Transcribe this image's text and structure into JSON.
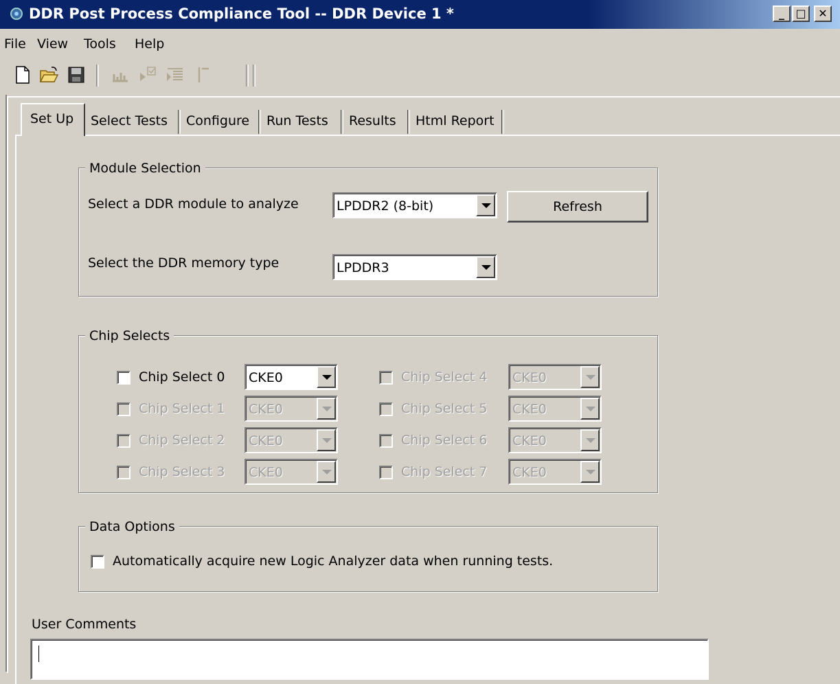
{
  "window": {
    "title": "DDR Post Process Compliance Tool -- DDR Device 1 *",
    "minimize_label": "_",
    "maximize_label": "□",
    "close_label": "✕"
  },
  "menu": {
    "items": [
      "File",
      "View",
      "Tools",
      "Help"
    ]
  },
  "toolbar": {
    "icons": [
      "new-file-icon",
      "open-folder-icon",
      "save-icon",
      "chart-icon",
      "run-check-icon",
      "list-filter-icon",
      "marker-icon",
      "vertical-separator-icon"
    ]
  },
  "tabs": {
    "items": [
      "Set Up",
      "Select Tests",
      "Configure",
      "Run Tests",
      "Results",
      "Html Report"
    ],
    "active": "Set Up"
  },
  "module_selection": {
    "legend": "Module Selection",
    "module_label": "Select a DDR module to analyze",
    "module_value": "LPDDR2 (8-bit)",
    "refresh_label": "Refresh",
    "memory_label": "Select the DDR memory type",
    "memory_value": "LPDDR3"
  },
  "chip_selects": {
    "legend": "Chip Selects",
    "items": [
      {
        "label": "Chip Select 0",
        "value": "CKE0",
        "enabled": true,
        "checked": false
      },
      {
        "label": "Chip Select 1",
        "value": "CKE0",
        "enabled": false,
        "checked": false
      },
      {
        "label": "Chip Select 2",
        "value": "CKE0",
        "enabled": false,
        "checked": false
      },
      {
        "label": "Chip Select 3",
        "value": "CKE0",
        "enabled": false,
        "checked": false
      },
      {
        "label": "Chip Select 4",
        "value": "CKE0",
        "enabled": false,
        "checked": false
      },
      {
        "label": "Chip Select 5",
        "value": "CKE0",
        "enabled": false,
        "checked": false
      },
      {
        "label": "Chip Select 6",
        "value": "CKE0",
        "enabled": false,
        "checked": false
      },
      {
        "label": "Chip Select 7",
        "value": "CKE0",
        "enabled": false,
        "checked": false
      }
    ]
  },
  "data_options": {
    "legend": "Data Options",
    "auto_acquire_label": "Automatically acquire new Logic Analyzer data when running tests.",
    "auto_acquire_checked": false
  },
  "user_comments": {
    "label": "User Comments",
    "value": ""
  },
  "colors": {
    "titlebar": "#0a246a",
    "face": "#d4d0c8",
    "disabled_text": "#a0a0a0"
  }
}
